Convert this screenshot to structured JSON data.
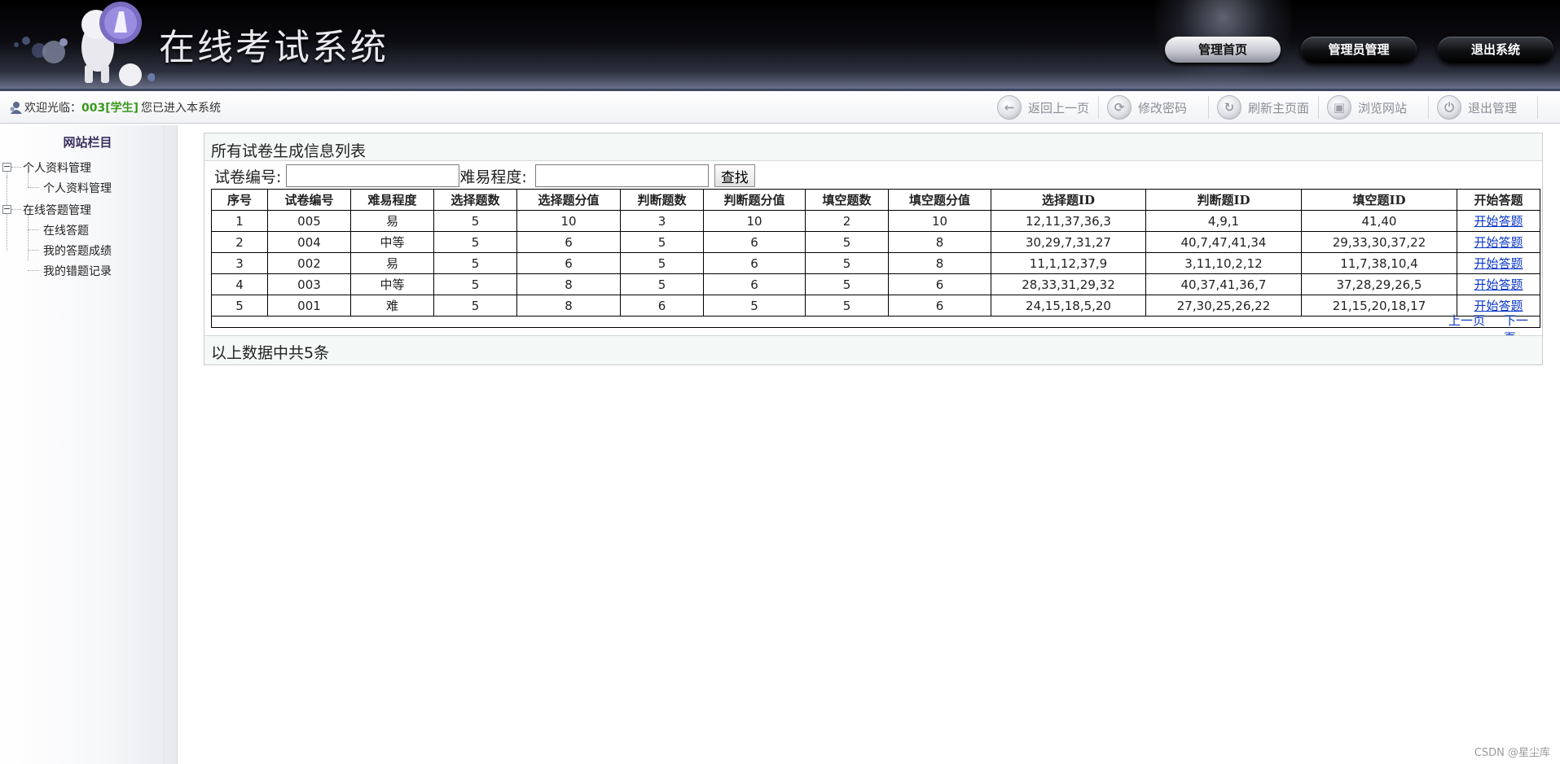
{
  "header": {
    "title": "在线考试系统",
    "nav": [
      {
        "label": "管理首页",
        "active": true
      },
      {
        "label": "管理员管理",
        "active": false
      },
      {
        "label": "退出系统",
        "active": false
      }
    ]
  },
  "toolbar": {
    "welcome_prefix": "欢迎光临：",
    "user": "003[学生]",
    "welcome_suffix": "您已进入本系统",
    "buttons": [
      {
        "label": "返回上一页",
        "icon": "back-arrow-icon"
      },
      {
        "label": "修改密码",
        "icon": "password-icon"
      },
      {
        "label": "刷新主页面",
        "icon": "refresh-icon"
      },
      {
        "label": "浏览网站",
        "icon": "browse-icon"
      },
      {
        "label": "退出管理",
        "icon": "power-icon"
      }
    ]
  },
  "sidebar": {
    "title": "网站栏目",
    "groups": [
      {
        "label": "个人资料管理",
        "items": [
          "个人资料管理"
        ]
      },
      {
        "label": "在线答题管理",
        "items": [
          "在线答题",
          "我的答题成绩",
          "我的错题记录"
        ]
      }
    ]
  },
  "main": {
    "title": "所有试卷生成信息列表",
    "search": {
      "paper_no_label": "试卷编号:",
      "paper_no_value": "",
      "difficulty_label": "难易程度:",
      "difficulty_value": "",
      "button": "查找"
    },
    "table": {
      "headers": [
        "序号",
        "试卷编号",
        "难易程度",
        "选择题数",
        "选择题分值",
        "判断题数",
        "判断题分值",
        "填空题数",
        "填空题分值",
        "选择题ID",
        "判断题ID",
        "填空题ID",
        "开始答题"
      ],
      "rows": [
        [
          "1",
          "005",
          "易",
          "5",
          "10",
          "3",
          "10",
          "2",
          "10",
          "12,11,37,36,3",
          "4,9,1",
          "41,40",
          "开始答题"
        ],
        [
          "2",
          "004",
          "中等",
          "5",
          "6",
          "5",
          "6",
          "5",
          "8",
          "30,29,7,31,27",
          "40,7,47,41,34",
          "29,33,30,37,22",
          "开始答题"
        ],
        [
          "3",
          "002",
          "易",
          "5",
          "6",
          "5",
          "6",
          "5",
          "8",
          "11,1,12,37,9",
          "3,11,10,2,12",
          "11,7,38,10,4",
          "开始答题"
        ],
        [
          "4",
          "003",
          "中等",
          "5",
          "8",
          "5",
          "6",
          "5",
          "6",
          "28,33,31,29,32",
          "40,37,41,36,7",
          "37,28,29,26,5",
          "开始答题"
        ],
        [
          "5",
          "001",
          "难",
          "5",
          "8",
          "6",
          "5",
          "5",
          "6",
          "24,15,18,5,20",
          "27,30,25,26,22",
          "21,15,20,18,17",
          "开始答题"
        ]
      ]
    },
    "pager": {
      "prev": "上一页",
      "next": "下一页"
    },
    "footer": "以上数据中共5条"
  },
  "watermark": "CSDN @星尘库"
}
